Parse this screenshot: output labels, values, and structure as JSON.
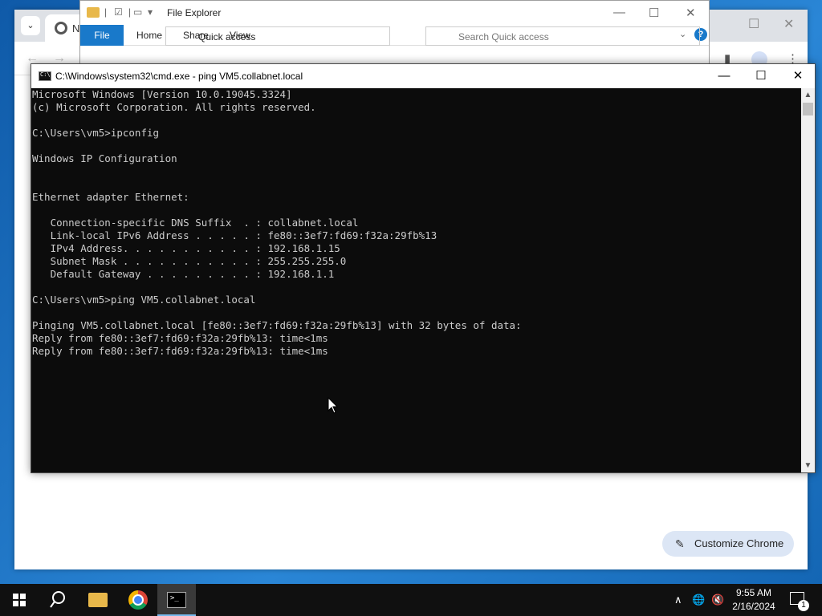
{
  "chrome": {
    "tab_title": "N",
    "customize_label": "Customize Chrome"
  },
  "explorer": {
    "title": "File Explorer",
    "ribbon_tabs": [
      "File",
      "Home",
      "Share",
      "View"
    ],
    "address": "Quick access",
    "search_placeholder": "Search Quick access"
  },
  "cmd": {
    "title": "C:\\Windows\\system32\\cmd.exe - ping  VM5.collabnet.local",
    "lines": [
      "Microsoft Windows [Version 10.0.19045.3324]",
      "(c) Microsoft Corporation. All rights reserved.",
      "",
      "C:\\Users\\vm5>ipconfig",
      "",
      "Windows IP Configuration",
      "",
      "",
      "Ethernet adapter Ethernet:",
      "",
      "   Connection-specific DNS Suffix  . : collabnet.local",
      "   Link-local IPv6 Address . . . . . : fe80::3ef7:fd69:f32a:29fb%13",
      "   IPv4 Address. . . . . . . . . . . : 192.168.1.15",
      "   Subnet Mask . . . . . . . . . . . : 255.255.255.0",
      "   Default Gateway . . . . . . . . . : 192.168.1.1",
      "",
      "C:\\Users\\vm5>ping VM5.collabnet.local",
      "",
      "Pinging VM5.collabnet.local [fe80::3ef7:fd69:f32a:29fb%13] with 32 bytes of data:",
      "Reply from fe80::3ef7:fd69:f32a:29fb%13: time<1ms",
      "Reply from fe80::3ef7:fd69:f32a:29fb%13: time<1ms"
    ]
  },
  "taskbar": {
    "time": "9:55 AM",
    "date": "2/16/2024",
    "notification_count": "1"
  }
}
